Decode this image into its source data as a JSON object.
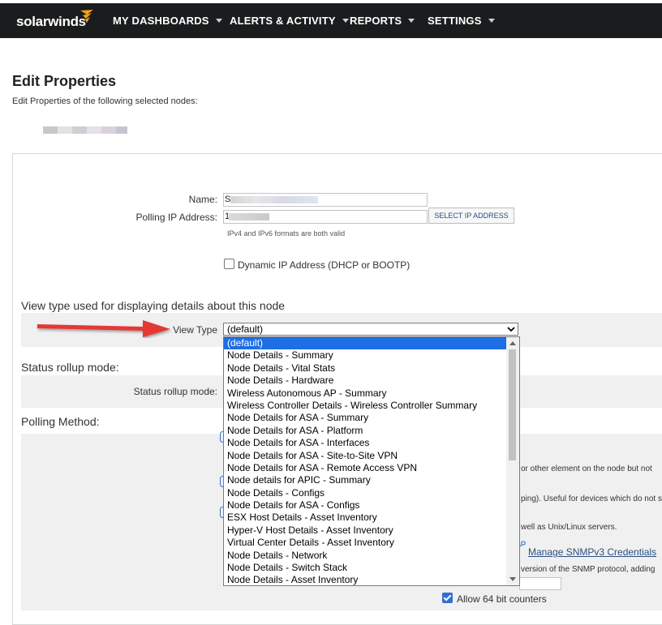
{
  "header": {
    "logo": "solarwinds",
    "nav": [
      {
        "label": "MY DASHBOARDS"
      },
      {
        "label": "ALERTS & ACTIVITY"
      },
      {
        "label": "REPORTS"
      },
      {
        "label": "SETTINGS"
      }
    ]
  },
  "page": {
    "title": "Edit Properties",
    "subtitle": "Edit Properties of the following selected nodes:"
  },
  "form": {
    "name_label": "Name:",
    "name_value_prefix": "S",
    "polling_ip_label": "Polling IP Address:",
    "polling_ip_prefix": "1",
    "select_ip_button": "SELECT IP ADDRESS",
    "ip_hint": "IPv4 and IPv6 formats are both valid",
    "dynamic_ip_label": "Dynamic IP Address (DHCP or BOOTP)",
    "view_type_section": "View type used for displaying details about this node",
    "view_type_label": "View Type",
    "view_type_value": "(default)",
    "status_rollup_section": "Status rollup mode:",
    "status_rollup_label": "Status rollup mode:",
    "polling_method_section": "Polling Method:",
    "partial_text_1": "or other element on the node but not",
    "partial_text_2": "ping). Useful for devices which do not s",
    "partial_text_3": "well as Unix/Linux servers.",
    "manage_snmpv3_link": "Manage SNMPv3 Credentials",
    "partial_text_4": "version of the SNMP protocol, adding",
    "allow_64bit_label": "Allow 64 bit counters"
  },
  "dropdown": {
    "options": [
      "(default)",
      "Node Details - Summary",
      "Node Details - Vital Stats",
      "Node Details - Hardware",
      "Wireless Autonomous AP - Summary",
      "Wireless Controller Details - Wireless Controller Summary",
      "Node Details for ASA - Summary",
      "Node Details for ASA - Platform",
      "Node Details for ASA - Interfaces",
      "Node Details for ASA - Site-to-Site VPN",
      "Node Details for ASA - Remote Access VPN",
      "Node details for APIC - Summary",
      "Node Details - Configs",
      "Node Details for ASA - Configs",
      "ESX Host Details - Asset Inventory",
      "Hyper-V Host Details - Asset Inventory",
      "Virtual Center Details - Asset Inventory",
      "Node Details - Network",
      "Node Details - Switch Stack",
      "Node Details - Asset Inventory"
    ],
    "selected_index": 0
  },
  "colors": {
    "topbar": "#1b1c1d",
    "logo_accent": "#f99d1c",
    "selection": "#1e6ee6",
    "annotation_arrow": "#e53935"
  }
}
